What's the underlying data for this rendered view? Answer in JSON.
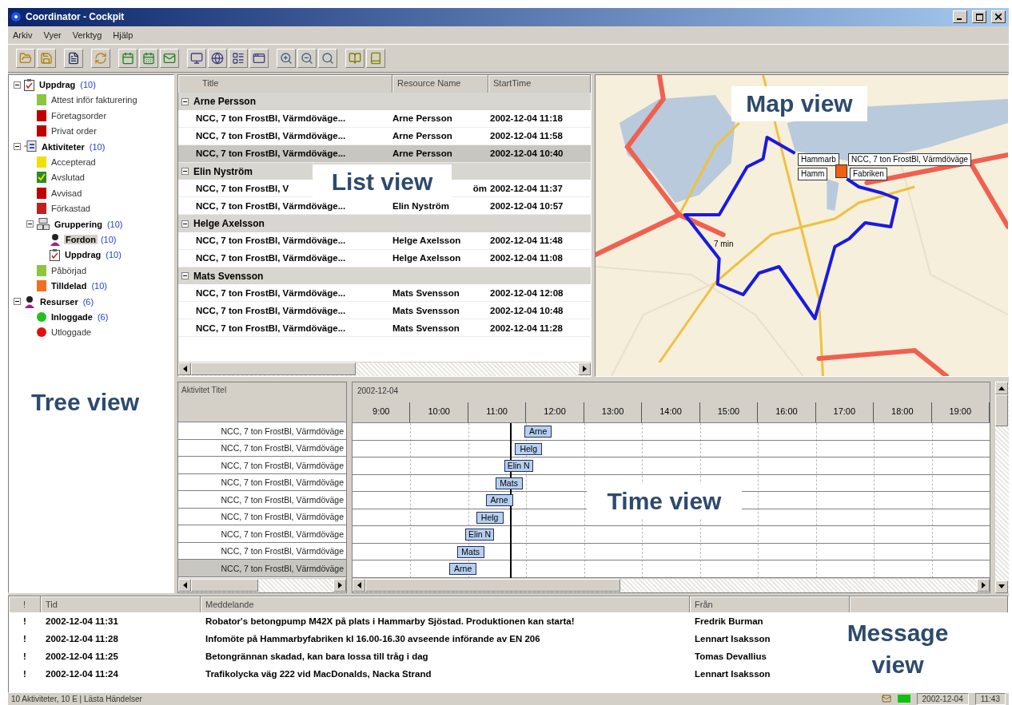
{
  "window": {
    "title": "Coordinator - Cockpit"
  },
  "menu": [
    "Arkiv",
    "Vyer",
    "Verktyg",
    "Hjälp"
  ],
  "tree": {
    "callout": "Tree view",
    "items": [
      {
        "label": "Uppdrag",
        "count": "(10)",
        "kind": "clipboard",
        "emphasized": true,
        "expanded": true,
        "selected": false,
        "children": [
          {
            "label": "Attest inför fakturering",
            "kind": "square",
            "color": "#8cc63f",
            "emphasized": false,
            "selected": false
          },
          {
            "label": "Företagsorder",
            "kind": "square",
            "color": "#c00000",
            "emphasized": false,
            "selected": false
          },
          {
            "label": "Privat order",
            "kind": "square",
            "color": "#c00000",
            "emphasized": false,
            "selected": false
          }
        ]
      },
      {
        "label": "Aktiviteter",
        "count": "(10)",
        "kind": "activities",
        "emphasized": true,
        "expanded": true,
        "selected": false,
        "children": [
          {
            "label": "Accepterad",
            "kind": "square",
            "color": "#f0e000",
            "emphasized": false,
            "selected": false
          },
          {
            "label": "Avslutad",
            "kind": "check",
            "color": "#2a8a2a",
            "emphasized": false,
            "selected": false
          },
          {
            "label": "Avvisad",
            "kind": "square",
            "color": "#c00000",
            "emphasized": false,
            "selected": false
          },
          {
            "label": "Förkastad",
            "kind": "square",
            "color": "#c02020",
            "emphasized": false,
            "selected": false
          },
          {
            "label": "Gruppering",
            "count": "(10)",
            "kind": "group",
            "emphasized": true,
            "expanded": true,
            "selected": false,
            "children": [
              {
                "label": "Fordon",
                "count": "(10)",
                "kind": "person",
                "emphasized": true,
                "selected": true
              },
              {
                "label": "Uppdrag",
                "count": "(10)",
                "kind": "clipboard",
                "emphasized": true,
                "selected": false
              }
            ]
          },
          {
            "label": "Påbörjad",
            "kind": "square",
            "color": "#8cc63f",
            "emphasized": false,
            "selected": false
          },
          {
            "label": "Tilldelad",
            "count": "(10)",
            "kind": "square",
            "color": "#f07020",
            "emphasized": true,
            "selected": false
          }
        ]
      },
      {
        "label": "Resurser",
        "count": "(6)",
        "kind": "person",
        "emphasized": true,
        "expanded": true,
        "selected": false,
        "children": [
          {
            "label": "Inloggade",
            "count": "(6)",
            "kind": "dot",
            "color": "#20c020",
            "emphasized": true,
            "selected": false
          },
          {
            "label": "Utloggade",
            "kind": "dot",
            "color": "#e01010",
            "emphasized": false,
            "selected": false
          }
        ]
      }
    ]
  },
  "list": {
    "columns": [
      "Title",
      "Resource Name",
      "StartTime"
    ],
    "callout": "List view",
    "groups": [
      {
        "name": "Arne Persson",
        "expanded": true,
        "rows": [
          {
            "kind": "row",
            "title": "NCC, 7 ton FrostBl, Värmdöväge...",
            "resource": "Arne Persson",
            "start": "2002-12-04 11:18",
            "selected": false
          },
          {
            "kind": "row",
            "title": "NCC, 7 ton FrostBl, Värmdöväge...",
            "resource": "Arne Persson",
            "start": "2002-12-04 11:58",
            "selected": false
          },
          {
            "kind": "row",
            "title": "NCC, 7 ton FrostBl, Värmdöväge...",
            "resource": "Arne Persson",
            "start": "2002-12-04 10:40",
            "selected": true
          }
        ]
      },
      {
        "name": "Elin Nyström",
        "expanded": true,
        "rows": [
          {
            "kind": "covered",
            "title": "NCC, 7 ton FrostBl, V",
            "resource": "öm",
            "start": "2002-12-04 11:37",
            "selected": false
          },
          {
            "kind": "row",
            "title": "NCC, 7 ton FrostBl, Värmdöväge...",
            "resource": "Elin Nyström",
            "start": "2002-12-04 10:57",
            "selected": false
          }
        ]
      },
      {
        "name": "Helge Axelsson",
        "expanded": true,
        "rows": [
          {
            "kind": "row",
            "title": "NCC, 7 ton FrostBl, Värmdöväge...",
            "resource": "Helge Axelsson",
            "start": "2002-12-04 11:48",
            "selected": false
          },
          {
            "kind": "row",
            "title": "NCC, 7 ton FrostBl, Värmdöväge...",
            "resource": "Helge Axelsson",
            "start": "2002-12-04 11:08",
            "selected": false
          }
        ]
      },
      {
        "name": "Mats Svensson",
        "expanded": true,
        "rows": [
          {
            "kind": "row",
            "title": "NCC, 7 ton FrostBl, Värmdöväge...",
            "resource": "Mats Svensson",
            "start": "2002-12-04 12:08",
            "selected": false
          },
          {
            "kind": "row",
            "title": "NCC, 7 ton FrostBl, Värmdöväge...",
            "resource": "Mats Svensson",
            "start": "2002-12-04 10:48",
            "selected": false
          },
          {
            "kind": "row",
            "title": "NCC, 7 ton FrostBl, Värmdöväge...",
            "resource": "Mats Svensson",
            "start": "2002-12-04 11:28",
            "selected": false
          }
        ]
      }
    ]
  },
  "map": {
    "callout": "Map view",
    "popups": [
      {
        "kind": "place",
        "text": "Hammarb"
      },
      {
        "kind": "vehicle",
        "text": "NCC, 7 ton FrostBl, Värmdöväge"
      },
      {
        "kind": "place",
        "text": "Hamm"
      },
      {
        "kind": "destination",
        "text": "Fabriken"
      },
      {
        "kind": "duration",
        "text": "7 min"
      }
    ]
  },
  "time_view": {
    "column_header": "Aktivitet Titel",
    "date": "2002-12-04",
    "now_line": {
      "level": 0.247
    },
    "callout": "Time view",
    "hours": [
      "9:00",
      "10:00",
      "11:00",
      "12:00",
      "13:00",
      "14:00",
      "15:00",
      "16:00",
      "17:00",
      "18:00",
      "19:00"
    ],
    "rows": [
      {
        "title": "NCC, 7 ton FrostBl, Värmdöväge",
        "bar": "Arne",
        "level": 0.27,
        "selected": false
      },
      {
        "title": "NCC, 7 ton FrostBl, Värmdöväge",
        "bar": "Helg",
        "level": 0.255,
        "selected": false
      },
      {
        "title": "NCC, 7 ton FrostBl, Värmdöväge",
        "bar": "Elin N",
        "level": 0.238,
        "selected": false
      },
      {
        "title": "NCC, 7 ton FrostBl, Värmdöväge",
        "bar": "Mats",
        "level": 0.224,
        "selected": false
      },
      {
        "title": "NCC, 7 ton FrostBl, Värmdöväge",
        "bar": "Arne",
        "level": 0.209,
        "selected": false
      },
      {
        "title": "NCC, 7 ton FrostBl, Värmdöväge",
        "bar": "Helg",
        "level": 0.194,
        "selected": false
      },
      {
        "title": "NCC, 7 ton FrostBl, Värmdöväge",
        "bar": "Elin N",
        "level": 0.177,
        "selected": false
      },
      {
        "title": "NCC, 7 ton FrostBl, Värmdöväge",
        "bar": "Mats",
        "level": 0.164,
        "selected": false
      },
      {
        "title": "NCC, 7 ton FrostBl, Värmdöväge",
        "bar": "Arne",
        "level": 0.152,
        "selected": true
      }
    ]
  },
  "messages": {
    "columns": [
      "!",
      "Tid",
      "Meddelande",
      "Från"
    ],
    "callout": "Message view",
    "rows": [
      {
        "priority": "!",
        "time": "2002-12-04 11:31",
        "text": "Robator's betongpump M42X på plats i Hammarby Sjöstad. Produktionen kan starta!",
        "from": "Fredrik Burman"
      },
      {
        "priority": "!",
        "time": "2002-12-04 11:28",
        "text": "Infomöte på Hammarbyfabriken kl 16.00-16.30 avseende införande av EN 206",
        "from": "Lennart Isaksson"
      },
      {
        "priority": "!",
        "time": "2002-12-04 11:25",
        "text": "Betongrännan skadad, kan bara lossa till tråg i dag",
        "from": "Tomas Devallius"
      },
      {
        "priority": "!",
        "time": "2002-12-04 11:24",
        "text": "Trafikolycka väg 222 vid MacDonalds, Nacka Strand",
        "from": "Lennart Isaksson"
      }
    ]
  },
  "status_bar": {
    "text": "10 Aktiviteter, 10 E | Lästa Händelser",
    "date": "2002-12-04",
    "time": "11:43"
  }
}
